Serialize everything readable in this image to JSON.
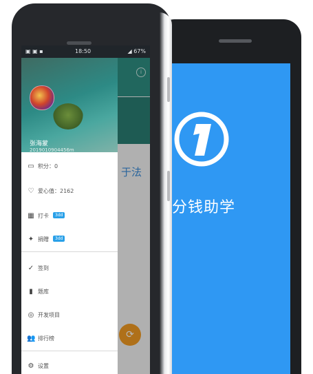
{
  "splash": {
    "brand_color": "#2f98f3",
    "logo_digit": "1",
    "title": "分钱助学"
  },
  "statusbar": {
    "time": "18:50",
    "left": "▣ ▣ ▪",
    "right": "◢ 67%"
  },
  "app": {
    "visible_title": "于法",
    "info_icon": "info-icon",
    "fab_icon": "refresh-icon"
  },
  "drawer": {
    "user_name": "张海蒙",
    "user_sub": "2019010904456m",
    "items": [
      {
        "icon": "wallet-icon",
        "label": "积分：0"
      },
      {
        "icon": "heart-icon",
        "label": "爱心值：2162"
      },
      {
        "icon": "calendar-icon",
        "label": "打卡",
        "badge": "3dd"
      },
      {
        "icon": "pin-icon",
        "label": "捐赠",
        "badge": "3dd"
      }
    ],
    "items2": [
      {
        "icon": "check-icon",
        "label": "签到"
      },
      {
        "icon": "book-icon",
        "label": "题库"
      },
      {
        "icon": "globe-icon",
        "label": "开发项目"
      },
      {
        "icon": "people-icon",
        "label": "排行榜"
      }
    ],
    "settings": {
      "icon": "gear-icon",
      "label": "设置"
    }
  }
}
